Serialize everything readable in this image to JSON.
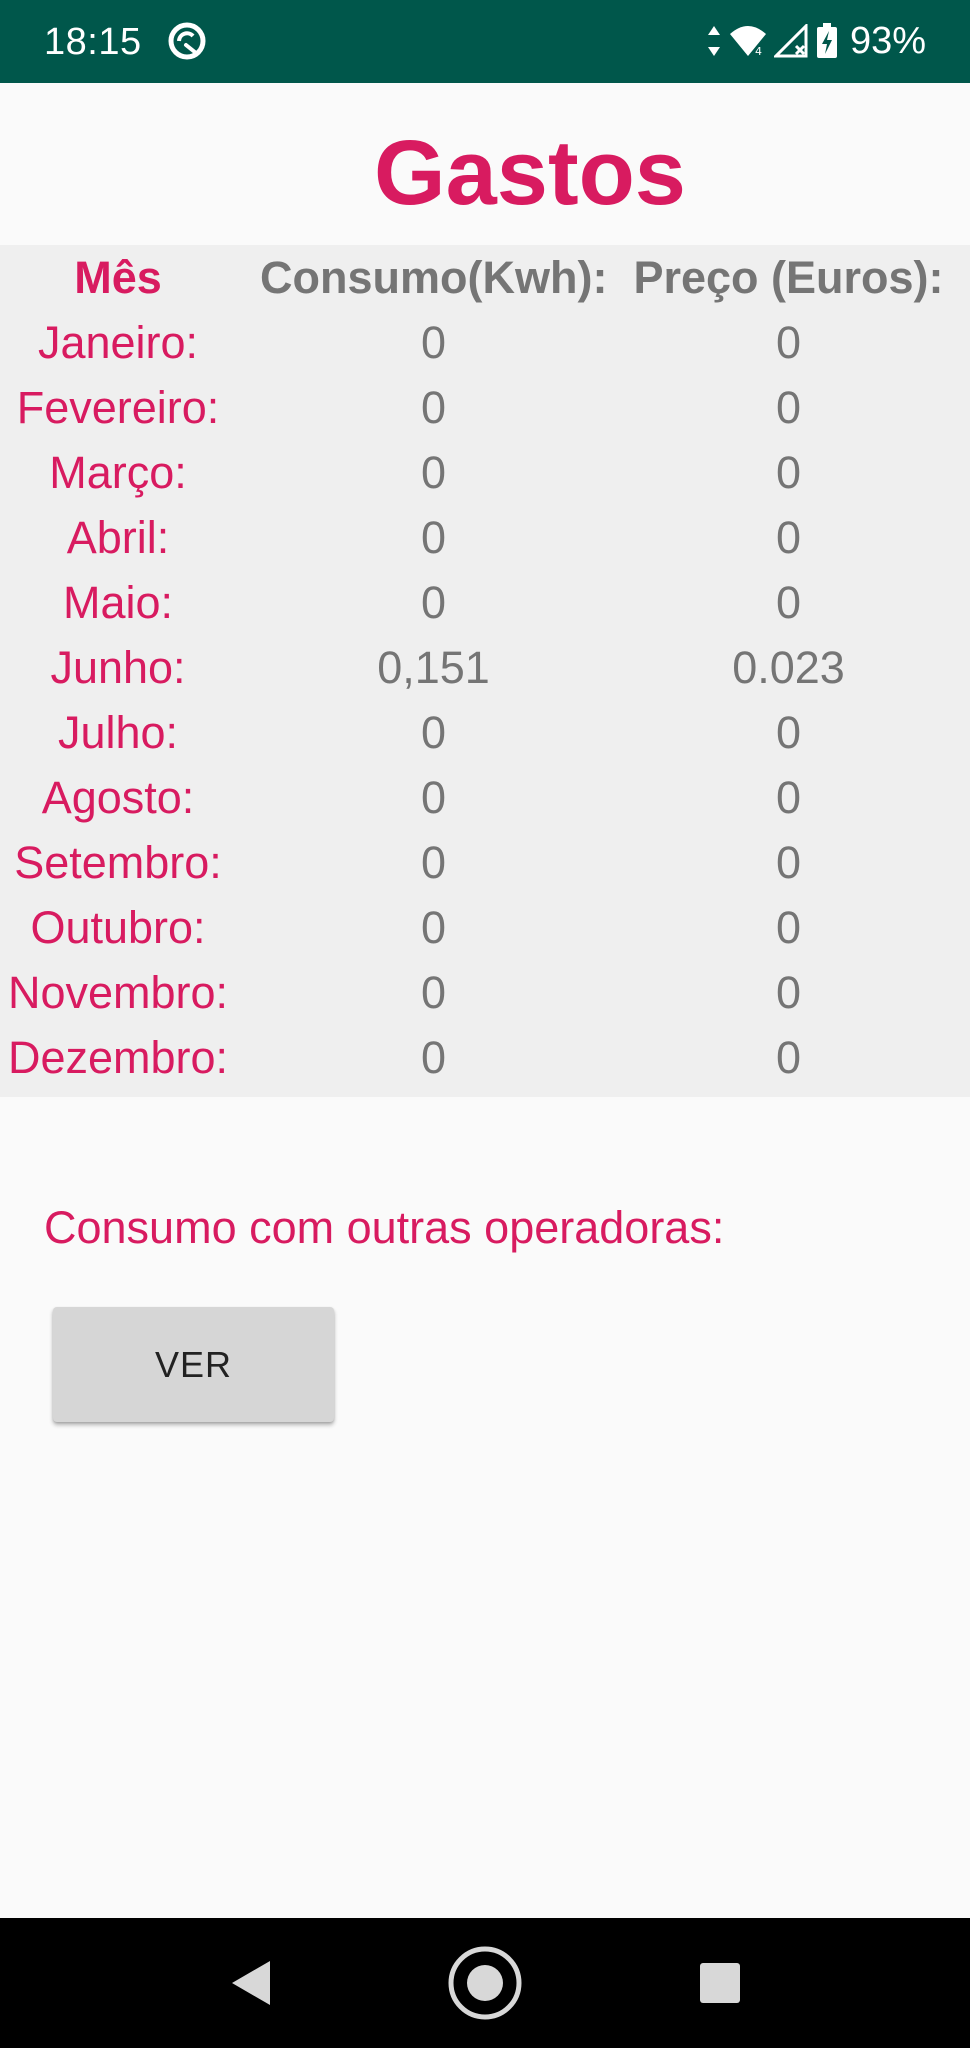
{
  "status_bar": {
    "time": "18:15",
    "battery": "93%",
    "icons": [
      "sync-circle-icon",
      "data-arrows-icon",
      "wifi-icon",
      "cell-signal-icon",
      "battery-charging-icon"
    ],
    "background": "#00574b"
  },
  "title": "Gastos",
  "table": {
    "headers": {
      "month": "Mês",
      "consumption": "Consumo(Kwh):",
      "price": "Preço (Euros):"
    },
    "rows": [
      {
        "month": "Janeiro:",
        "consumption": "0",
        "price": "0"
      },
      {
        "month": "Fevereiro:",
        "consumption": "0",
        "price": "0"
      },
      {
        "month": "Março:",
        "consumption": "0",
        "price": "0"
      },
      {
        "month": "Abril:",
        "consumption": "0",
        "price": "0"
      },
      {
        "month": "Maio:",
        "consumption": "0",
        "price": "0"
      },
      {
        "month": "Junho:",
        "consumption": "0,151",
        "price": "0.023"
      },
      {
        "month": "Julho:",
        "consumption": "0",
        "price": "0"
      },
      {
        "month": "Agosto:",
        "consumption": "0",
        "price": "0"
      },
      {
        "month": "Setembro:",
        "consumption": "0",
        "price": "0"
      },
      {
        "month": "Outubro:",
        "consumption": "0",
        "price": "0"
      },
      {
        "month": "Novembro:",
        "consumption": "0",
        "price": "0"
      },
      {
        "month": "Dezembro:",
        "consumption": "0",
        "price": "0"
      }
    ]
  },
  "other_operators": {
    "label": "Consumo com outras operadoras:",
    "button_label": "VER"
  },
  "nav_bar": {
    "icons": [
      "back-icon",
      "home-icon",
      "recents-icon"
    ]
  },
  "colors": {
    "accent": "#d81b60",
    "value_text": "#757575",
    "table_background": "#efefef",
    "page_background": "#fafafa"
  }
}
